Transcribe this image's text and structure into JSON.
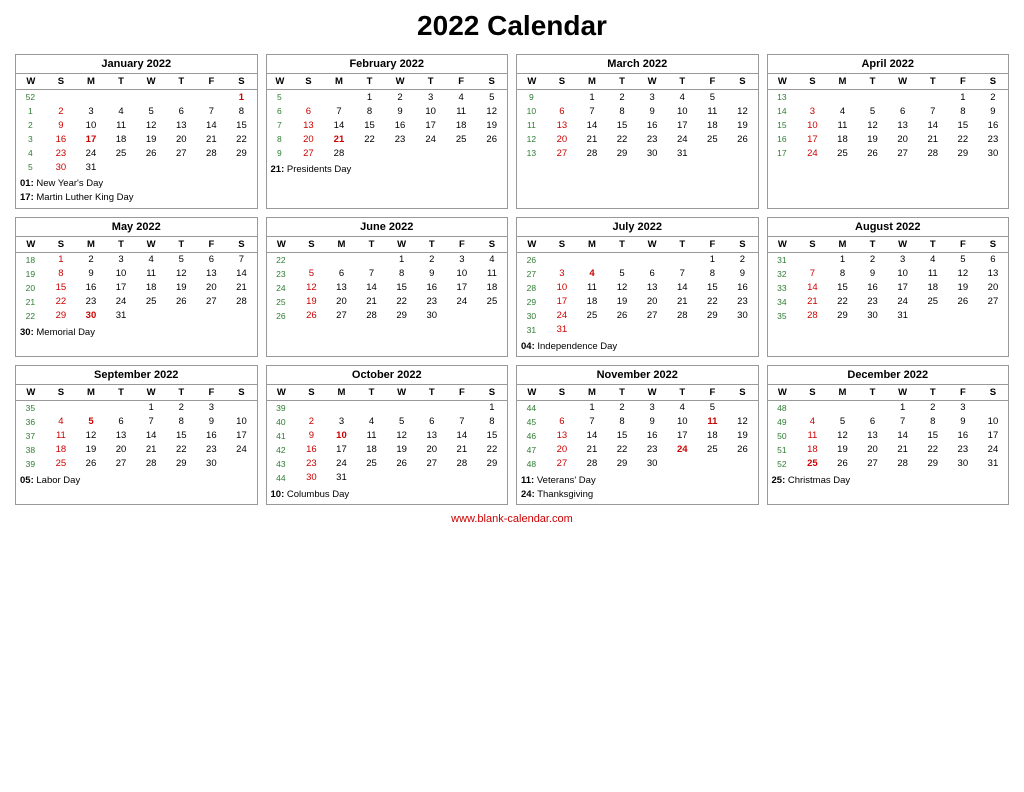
{
  "title": "2022 Calendar",
  "website": "www.blank-calendar.com",
  "months": [
    {
      "name": "January 2022",
      "headers": [
        "W",
        "S",
        "M",
        "T",
        "W",
        "T",
        "F",
        "S"
      ],
      "rows": [
        [
          "52",
          "",
          "",
          "",
          "",
          "",
          "",
          "1"
        ],
        [
          "1",
          "2",
          "3",
          "4",
          "5",
          "6",
          "7",
          "8"
        ],
        [
          "2",
          "9",
          "10",
          "11",
          "12",
          "13",
          "14",
          "15"
        ],
        [
          "3",
          "16",
          "17",
          "18",
          "19",
          "20",
          "21",
          "22"
        ],
        [
          "4",
          "23",
          "24",
          "25",
          "26",
          "27",
          "28",
          "29"
        ],
        [
          "5",
          "30",
          "31",
          "",
          "",
          "",
          "",
          ""
        ]
      ],
      "redDays": [
        "1",
        "17"
      ],
      "holidays": [
        {
          "num": "01",
          "name": "New Year's Day"
        },
        {
          "num": "17",
          "name": "Martin Luther King Day"
        }
      ]
    },
    {
      "name": "February 2022",
      "headers": [
        "W",
        "S",
        "M",
        "T",
        "W",
        "T",
        "F",
        "S"
      ],
      "rows": [
        [
          "5",
          "",
          "",
          "1",
          "2",
          "3",
          "4",
          "5"
        ],
        [
          "6",
          "6",
          "7",
          "8",
          "9",
          "10",
          "11",
          "12"
        ],
        [
          "7",
          "13",
          "14",
          "15",
          "16",
          "17",
          "18",
          "19"
        ],
        [
          "8",
          "20",
          "21",
          "22",
          "23",
          "24",
          "25",
          "26"
        ],
        [
          "9",
          "27",
          "28",
          "",
          "",
          "",
          "",
          ""
        ]
      ],
      "redDays": [
        "21"
      ],
      "holidays": [
        {
          "num": "21",
          "name": "Presidents Day"
        }
      ]
    },
    {
      "name": "March 2022",
      "headers": [
        "W",
        "S",
        "M",
        "T",
        "W",
        "T",
        "F",
        "S"
      ],
      "rows": [
        [
          "9",
          "",
          "1",
          "2",
          "3",
          "4",
          "5"
        ],
        [
          "10",
          "6",
          "7",
          "8",
          "9",
          "10",
          "11",
          "12"
        ],
        [
          "11",
          "13",
          "14",
          "15",
          "16",
          "17",
          "18",
          "19"
        ],
        [
          "12",
          "20",
          "21",
          "22",
          "23",
          "24",
          "25",
          "26"
        ],
        [
          "13",
          "27",
          "28",
          "29",
          "30",
          "31",
          "",
          ""
        ]
      ],
      "redDays": [],
      "holidays": []
    },
    {
      "name": "April 2022",
      "headers": [
        "W",
        "S",
        "M",
        "T",
        "W",
        "T",
        "F",
        "S"
      ],
      "rows": [
        [
          "13",
          "",
          "",
          "",
          "",
          "",
          "1",
          "2"
        ],
        [
          "14",
          "3",
          "4",
          "5",
          "6",
          "7",
          "8",
          "9"
        ],
        [
          "15",
          "10",
          "11",
          "12",
          "13",
          "14",
          "15",
          "16"
        ],
        [
          "16",
          "17",
          "18",
          "19",
          "20",
          "21",
          "22",
          "23"
        ],
        [
          "17",
          "24",
          "25",
          "26",
          "27",
          "28",
          "29",
          "30"
        ]
      ],
      "redDays": [],
      "holidays": []
    },
    {
      "name": "May 2022",
      "headers": [
        "W",
        "S",
        "M",
        "T",
        "W",
        "T",
        "F",
        "S"
      ],
      "rows": [
        [
          "18",
          "1",
          "2",
          "3",
          "4",
          "5",
          "6",
          "7"
        ],
        [
          "19",
          "8",
          "9",
          "10",
          "11",
          "12",
          "13",
          "14"
        ],
        [
          "20",
          "15",
          "16",
          "17",
          "18",
          "19",
          "20",
          "21"
        ],
        [
          "21",
          "22",
          "23",
          "24",
          "25",
          "26",
          "27",
          "28"
        ],
        [
          "22",
          "29",
          "30",
          "31",
          "",
          "",
          "",
          ""
        ]
      ],
      "redDays": [
        "30"
      ],
      "holidays": [
        {
          "num": "30",
          "name": "Memorial Day"
        }
      ]
    },
    {
      "name": "June 2022",
      "headers": [
        "W",
        "S",
        "M",
        "T",
        "W",
        "T",
        "F",
        "S"
      ],
      "rows": [
        [
          "22",
          "",
          "",
          "",
          "1",
          "2",
          "3",
          "4"
        ],
        [
          "23",
          "5",
          "6",
          "7",
          "8",
          "9",
          "10",
          "11"
        ],
        [
          "24",
          "12",
          "13",
          "14",
          "15",
          "16",
          "17",
          "18"
        ],
        [
          "25",
          "19",
          "20",
          "21",
          "22",
          "23",
          "24",
          "25"
        ],
        [
          "26",
          "26",
          "27",
          "28",
          "29",
          "30",
          "",
          ""
        ]
      ],
      "redDays": [],
      "holidays": []
    },
    {
      "name": "July 2022",
      "headers": [
        "W",
        "S",
        "M",
        "T",
        "W",
        "T",
        "F",
        "S"
      ],
      "rows": [
        [
          "26",
          "",
          "",
          "",
          "",
          "",
          "1",
          "2"
        ],
        [
          "27",
          "3",
          "4",
          "5",
          "6",
          "7",
          "8",
          "9"
        ],
        [
          "28",
          "10",
          "11",
          "12",
          "13",
          "14",
          "15",
          "16"
        ],
        [
          "29",
          "17",
          "18",
          "19",
          "20",
          "21",
          "22",
          "23"
        ],
        [
          "30",
          "24",
          "25",
          "26",
          "27",
          "28",
          "29",
          "30"
        ],
        [
          "31",
          "31",
          "",
          "",
          "",
          "",
          "",
          ""
        ]
      ],
      "redDays": [
        "4"
      ],
      "holidays": [
        {
          "num": "04",
          "name": "Independence Day"
        }
      ]
    },
    {
      "name": "August 2022",
      "headers": [
        "W",
        "S",
        "M",
        "T",
        "W",
        "T",
        "F",
        "S"
      ],
      "rows": [
        [
          "31",
          "",
          "1",
          "2",
          "3",
          "4",
          "5",
          "6"
        ],
        [
          "32",
          "7",
          "8",
          "9",
          "10",
          "11",
          "12",
          "13"
        ],
        [
          "33",
          "14",
          "15",
          "16",
          "17",
          "18",
          "19",
          "20"
        ],
        [
          "34",
          "21",
          "22",
          "23",
          "24",
          "25",
          "26",
          "27"
        ],
        [
          "35",
          "28",
          "29",
          "30",
          "31",
          "",
          "",
          ""
        ]
      ],
      "redDays": [],
      "holidays": []
    },
    {
      "name": "September 2022",
      "headers": [
        "W",
        "S",
        "M",
        "T",
        "W",
        "T",
        "F",
        "S"
      ],
      "rows": [
        [
          "35",
          "",
          "",
          "",
          "1",
          "2",
          "3"
        ],
        [
          "36",
          "4",
          "5",
          "6",
          "7",
          "8",
          "9",
          "10"
        ],
        [
          "37",
          "11",
          "12",
          "13",
          "14",
          "15",
          "16",
          "17"
        ],
        [
          "38",
          "18",
          "19",
          "20",
          "21",
          "22",
          "23",
          "24"
        ],
        [
          "39",
          "25",
          "26",
          "27",
          "28",
          "29",
          "30",
          ""
        ]
      ],
      "redDays": [
        "5"
      ],
      "holidays": [
        {
          "num": "05",
          "name": "Labor Day"
        }
      ]
    },
    {
      "name": "October 2022",
      "headers": [
        "W",
        "S",
        "M",
        "T",
        "W",
        "T",
        "F",
        "S"
      ],
      "rows": [
        [
          "39",
          "",
          "",
          "",
          "",
          "",
          "",
          "1"
        ],
        [
          "40",
          "2",
          "3",
          "4",
          "5",
          "6",
          "7",
          "8"
        ],
        [
          "41",
          "9",
          "10",
          "11",
          "12",
          "13",
          "14",
          "15"
        ],
        [
          "42",
          "16",
          "17",
          "18",
          "19",
          "20",
          "21",
          "22"
        ],
        [
          "43",
          "23",
          "24",
          "25",
          "26",
          "27",
          "28",
          "29"
        ],
        [
          "44",
          "30",
          "31",
          "",
          "",
          "",
          "",
          ""
        ]
      ],
      "redDays": [
        "10"
      ],
      "holidays": [
        {
          "num": "10",
          "name": "Columbus Day"
        }
      ]
    },
    {
      "name": "November 2022",
      "headers": [
        "W",
        "S",
        "M",
        "T",
        "W",
        "T",
        "F",
        "S"
      ],
      "rows": [
        [
          "44",
          "",
          "1",
          "2",
          "3",
          "4",
          "5"
        ],
        [
          "45",
          "6",
          "7",
          "8",
          "9",
          "10",
          "11",
          "12"
        ],
        [
          "46",
          "13",
          "14",
          "15",
          "16",
          "17",
          "18",
          "19"
        ],
        [
          "47",
          "20",
          "21",
          "22",
          "23",
          "24",
          "25",
          "26"
        ],
        [
          "48",
          "27",
          "28",
          "29",
          "30",
          "",
          "",
          ""
        ]
      ],
      "redDays": [
        "11",
        "24"
      ],
      "holidays": [
        {
          "num": "11",
          "name": "Veterans' Day"
        },
        {
          "num": "24",
          "name": "Thanksgiving"
        }
      ]
    },
    {
      "name": "December 2022",
      "headers": [
        "W",
        "S",
        "M",
        "T",
        "W",
        "T",
        "F",
        "S"
      ],
      "rows": [
        [
          "48",
          "",
          "",
          "",
          "1",
          "2",
          "3"
        ],
        [
          "49",
          "4",
          "5",
          "6",
          "7",
          "8",
          "9",
          "10"
        ],
        [
          "50",
          "11",
          "12",
          "13",
          "14",
          "15",
          "16",
          "17"
        ],
        [
          "51",
          "18",
          "19",
          "20",
          "21",
          "22",
          "23",
          "24"
        ],
        [
          "52",
          "25",
          "26",
          "27",
          "28",
          "29",
          "30",
          "31"
        ]
      ],
      "redDays": [
        "25"
      ],
      "holidays": [
        {
          "num": "25",
          "name": "Christmas Day"
        }
      ]
    }
  ]
}
